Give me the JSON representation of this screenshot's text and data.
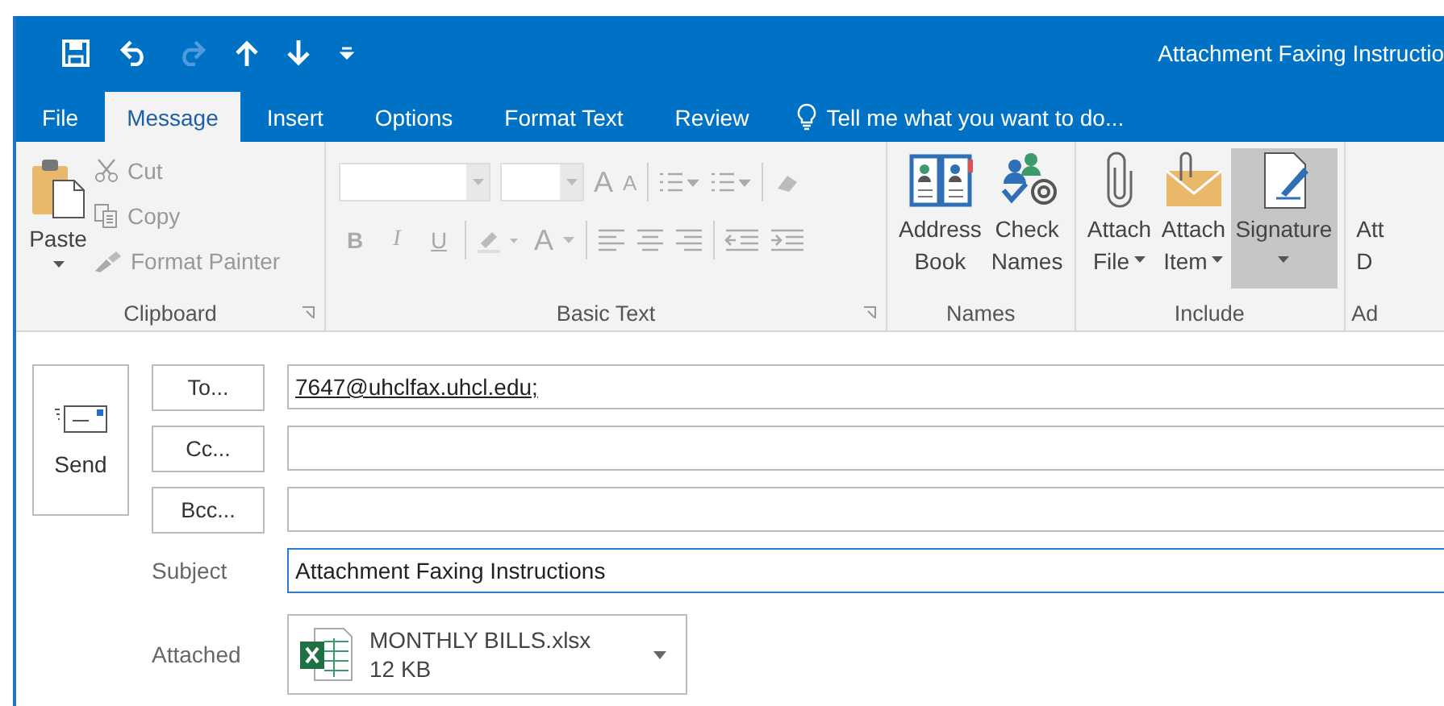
{
  "window": {
    "title": "Attachment Faxing Instructio"
  },
  "tabs": [
    {
      "label": "File",
      "selected": false
    },
    {
      "label": "Message",
      "selected": true
    },
    {
      "label": "Insert",
      "selected": false
    },
    {
      "label": "Options",
      "selected": false
    },
    {
      "label": "Format Text",
      "selected": false
    },
    {
      "label": "Review",
      "selected": false
    }
  ],
  "tell_me": {
    "placeholder": "Tell me what you want to do..."
  },
  "ribbon": {
    "clipboard": {
      "label": "Clipboard",
      "paste": "Paste",
      "items": [
        {
          "kind": "cut",
          "label": "Cut",
          "disabled": true
        },
        {
          "kind": "copy",
          "label": "Copy",
          "disabled": true
        },
        {
          "kind": "painter",
          "label": "Format Painter",
          "disabled": true
        }
      ]
    },
    "basic_text": {
      "label": "Basic Text",
      "grow": "A",
      "shrink": "A",
      "format": [
        {
          "label": "B",
          "disabled": true
        },
        {
          "label": "I",
          "disabled": true
        },
        {
          "label": "U",
          "disabled": true
        }
      ],
      "font_color": "A"
    },
    "names": {
      "label": "Names",
      "items": [
        {
          "kind": "book",
          "line1": "Address",
          "line2": "Book"
        },
        {
          "kind": "check",
          "line1": "Check",
          "line2": "Names"
        }
      ]
    },
    "include": {
      "label": "Include",
      "items": [
        {
          "kind": "file",
          "line1": "Attach",
          "line2": "File",
          "highlighted": false
        },
        {
          "kind": "item",
          "line1": "Attach",
          "line2": "Item",
          "highlighted": false
        },
        {
          "kind": "signature",
          "line1": "Signature",
          "highlighted": true
        }
      ]
    },
    "cut_group": {
      "line1": "Att",
      "line2": "D",
      "label": "Ad"
    }
  },
  "compose": {
    "send": "Send",
    "recipients": [
      {
        "button": "To...",
        "value": "7647@uhclfax.uhcl.edu;"
      },
      {
        "button": "Cc..."
      },
      {
        "button": "Bcc..."
      }
    ],
    "subject_label": "Subject",
    "subject": "Attachment Faxing Instructions",
    "attached_label": "Attached",
    "attachment": {
      "name": "MONTHLY BILLS.xlsx",
      "size": "12 KB"
    }
  }
}
